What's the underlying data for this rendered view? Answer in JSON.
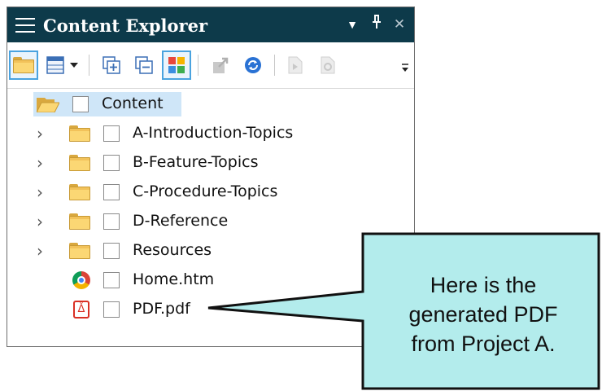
{
  "panel": {
    "title": "Content Explorer",
    "menu_icon": "hamburger-icon",
    "dropdown_glyph": "▼",
    "pin_glyph": "ᚌ",
    "close_glyph": "✕"
  },
  "toolbar": {
    "buttons": [
      {
        "name": "folder-view",
        "icon": "folder-icon",
        "selected": true
      },
      {
        "name": "layout",
        "icon": "layout-icon",
        "dropdown": true
      },
      {
        "name": "expand-all",
        "icon": "expand-icon"
      },
      {
        "name": "collapse-all",
        "icon": "collapse-icon"
      },
      {
        "name": "color-grid",
        "icon": "color-grid-icon",
        "selected": true
      },
      {
        "name": "publish",
        "icon": "publish-icon",
        "disabled": true
      },
      {
        "name": "refresh",
        "icon": "refresh-icon"
      },
      {
        "name": "bind",
        "icon": "bind-icon",
        "disabled": true
      },
      {
        "name": "unbind",
        "icon": "unbind-icon",
        "disabled": true
      }
    ],
    "overflow_glyph": "⌄"
  },
  "tree": {
    "root": {
      "label": "Content",
      "icon": "open-folder-icon"
    },
    "items": [
      {
        "label": "A-Introduction-Topics",
        "icon": "folder-icon",
        "expandable": true
      },
      {
        "label": "B-Feature-Topics",
        "icon": "folder-icon",
        "expandable": true
      },
      {
        "label": "C-Procedure-Topics",
        "icon": "folder-icon",
        "expandable": true
      },
      {
        "label": "D-Reference",
        "icon": "folder-icon",
        "expandable": true
      },
      {
        "label": "Resources",
        "icon": "folder-icon",
        "expandable": true
      },
      {
        "label": "Home.htm",
        "icon": "chrome-icon",
        "expandable": false
      },
      {
        "label": "PDF.pdf",
        "icon": "pdf-icon",
        "expandable": false
      }
    ],
    "chevron_glyph": "›"
  },
  "callout": {
    "lines": [
      "Here is the",
      "generated PDF",
      "from Project A."
    ],
    "fill": "#b3ecec",
    "border": "#111111"
  }
}
